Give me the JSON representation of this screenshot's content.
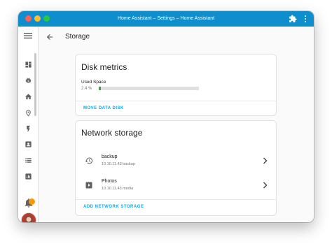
{
  "window": {
    "title": "Home Assistant – Settings – Home Assistant"
  },
  "header": {
    "title": "Storage"
  },
  "disk_metrics": {
    "title": "Disk metrics",
    "used_label": "Used Space",
    "used_percent_text": "2.4 %",
    "used_fraction": 0.024,
    "action_label": "MOVE DATA DISK",
    "bar_color": "#43a047"
  },
  "network_storage": {
    "title": "Network storage",
    "items": [
      {
        "name": "backup",
        "detail": "10.10.11.43 backup",
        "icon": "backup-restore-icon"
      },
      {
        "name": "Photos",
        "detail": "10.10.11.43 media",
        "icon": "play-box-icon"
      }
    ],
    "action_label": "ADD NETWORK STORAGE"
  },
  "sidebar": {
    "items": [
      "dashboard-icon",
      "bug-icon",
      "home-icon",
      "map-pin-icon",
      "energy-icon",
      "person-icon",
      "list-icon",
      "chart-icon"
    ]
  },
  "colors": {
    "titlebar": "#0e8ecd",
    "accent": "#03a9f4",
    "notification_badge": "#ff9800"
  }
}
